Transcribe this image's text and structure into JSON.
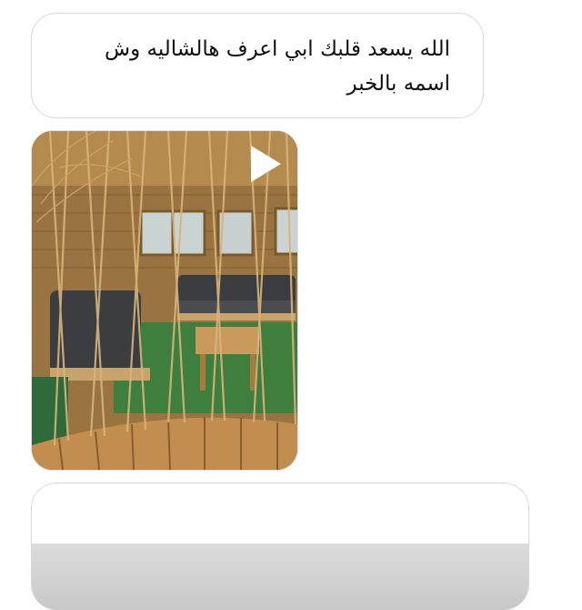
{
  "chat": {
    "messages": [
      {
        "type": "text",
        "lines": [
          "الله يسعد قلبك ابي اعرف هالشاليه وش",
          "اسمه بالخبر"
        ]
      },
      {
        "type": "video",
        "icon": "play-icon"
      },
      {
        "type": "image",
        "icon": "image-preview"
      }
    ]
  },
  "colors": {
    "bubble_border": "#d9d9d9",
    "text": "#111111",
    "background": "#ffffff"
  }
}
